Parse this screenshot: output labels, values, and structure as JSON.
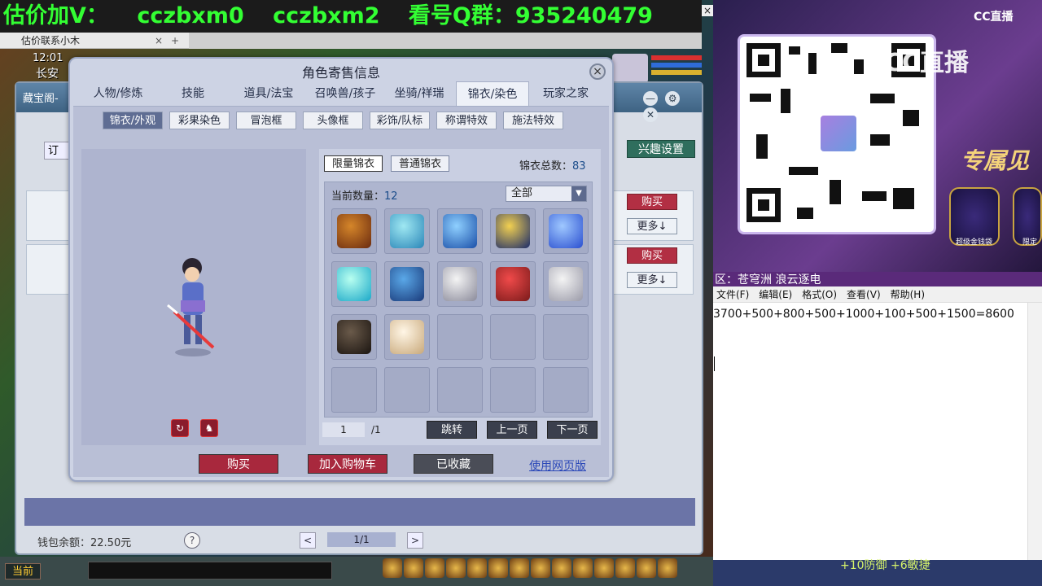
{
  "banner": {
    "segments": [
      "估价加V：",
      "cczbxm0",
      "cczbxm2",
      "看号Q群：935240479"
    ],
    "close": "×"
  },
  "browser_tab": {
    "title": "估价联系小木",
    "close": "×",
    "add": "+"
  },
  "hud": {
    "time": "12:01",
    "location": "长安"
  },
  "trade": {
    "title": "藏宝阁-",
    "controls": [
      "—",
      "⚙",
      "✕"
    ],
    "order_label": "订",
    "interest_button": "兴趣设置",
    "buy_label": "购买",
    "more_label": "更多↓",
    "wallet": "钱包余额：22.50元",
    "help": "?",
    "page": "1/1",
    "prev": "<",
    "next": ">"
  },
  "dialog": {
    "title": "角色寄售信息",
    "close": "×",
    "tabs": [
      "人物/修炼",
      "技能",
      "道具/法宝",
      "召唤兽/孩子",
      "坐骑/祥瑞",
      "锦衣/染色",
      "玩家之家"
    ],
    "active_tab": "锦衣/染色",
    "subtabs": [
      "锦衣/外观",
      "彩果染色",
      "冒泡框",
      "头像框",
      "彩饰/队标",
      "称谓特效",
      "施法特效"
    ],
    "active_subtab": "锦衣/外观",
    "preview_controls": [
      "↻",
      "♞"
    ],
    "filters": [
      "限量锦衣",
      "普通锦衣"
    ],
    "active_filter": "限量锦衣",
    "total_label": "锦衣总数：",
    "total_value": "83",
    "count_label": "当前数量：",
    "count_value": "12",
    "category": "全部",
    "page_current": "1",
    "page_total": "/1",
    "jump": "跳转",
    "prev_page": "上一页",
    "next_page": "下一页",
    "buy": "购买",
    "add_cart": "加入购物车",
    "favorited": "已收藏",
    "web_link": "使用网页版"
  },
  "items": [
    {
      "name": "fire-mace",
      "c1": "#d5862a",
      "c2": "#6a2a0f"
    },
    {
      "name": "feather-board",
      "c1": "#9fe8f2",
      "c2": "#2a86b8"
    },
    {
      "name": "blue-orb",
      "c1": "#8fd0ff",
      "c2": "#1a4fa8"
    },
    {
      "name": "portrait-card",
      "c1": "#f2d050",
      "c2": "#1a2a6a"
    },
    {
      "name": "water-swirl",
      "c1": "#9fc8ff",
      "c2": "#2a4fd0"
    },
    {
      "name": "cyan-flame",
      "c1": "#b8fff0",
      "c2": "#1aa8c8"
    },
    {
      "name": "blue-robe",
      "c1": "#5aa8e8",
      "c2": "#1a3a7a"
    },
    {
      "name": "white-robe",
      "c1": "#f4f4f4",
      "c2": "#8a8a9a"
    },
    {
      "name": "red-hair",
      "c1": "#f04a4a",
      "c2": "#7a1a1a"
    },
    {
      "name": "white-wings",
      "c1": "#f4f4f4",
      "c2": "#9a9aa8"
    },
    {
      "name": "dark-spider",
      "c1": "#6a5a4a",
      "c2": "#1a1410"
    },
    {
      "name": "cloud-mount",
      "c1": "#fff6e6",
      "c2": "#c8a87a"
    },
    {
      "name": "",
      "empty": true
    },
    {
      "name": "",
      "empty": true
    },
    {
      "name": "",
      "empty": true
    },
    {
      "name": "",
      "empty": true
    },
    {
      "name": "",
      "empty": true
    },
    {
      "name": "",
      "empty": true
    },
    {
      "name": "",
      "empty": true
    },
    {
      "name": "",
      "empty": true
    }
  ],
  "stream": {
    "brand": "CC直播",
    "watermark": "CC直播",
    "promo": "专属见",
    "promo_caps": [
      "超级金钱袋",
      "限定"
    ],
    "subtitle": "区：苍穹洲 浪云逐电"
  },
  "notepad": {
    "menu": [
      "文件(F)",
      "编辑(E)",
      "格式(O)",
      "查看(V)",
      "帮助(H)"
    ],
    "text": "3700+500+800+500+1000+100+500+1500=8600"
  },
  "bottom": {
    "current": "当前",
    "buff_text": "+10防御  +6敏捷"
  },
  "colors": {
    "banner_text": "#33ff33",
    "buy_red": "#a8283d",
    "link": "#2b48b8"
  }
}
